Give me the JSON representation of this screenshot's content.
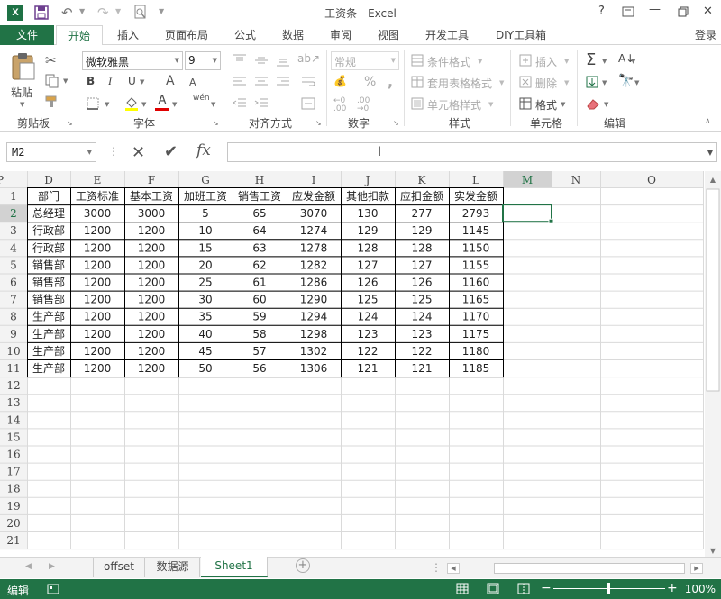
{
  "title": "工资条 - Excel",
  "window_controls": {
    "help": "?",
    "minimize": "—",
    "close": "✕"
  },
  "login": "登录",
  "tabs": [
    "文件",
    "开始",
    "插入",
    "页面布局",
    "公式",
    "数据",
    "审阅",
    "视图",
    "开发工具",
    "DIY工具箱"
  ],
  "active_tab": "开始",
  "ribbon": {
    "clipboard": {
      "paste": "粘贴",
      "label": "剪贴板"
    },
    "font": {
      "name": "微软雅黑",
      "size": "9",
      "bold": "B",
      "italic": "I",
      "underline": "U",
      "grow": "A",
      "shrink": "A",
      "color": "A",
      "label": "字体",
      "wen": "wén"
    },
    "alignment": {
      "label": "对齐方式"
    },
    "number": {
      "format": "常规",
      "percent": "%",
      "comma": ",",
      "label": "数字"
    },
    "styles": {
      "conditional": "条件格式",
      "table": "套用表格格式",
      "cell": "单元格样式",
      "label": "样式"
    },
    "cells": {
      "insert": "插入",
      "delete": "删除",
      "format": "格式",
      "label": "单元格"
    },
    "editing": {
      "label": "编辑"
    }
  },
  "name_box": "M2",
  "formula_value": "",
  "columns": [
    "D",
    "E",
    "F",
    "G",
    "H",
    "I",
    "J",
    "K",
    "L",
    "M",
    "N",
    "O",
    "P"
  ],
  "selected_column": "M",
  "rows": [
    "1",
    "2",
    "3",
    "4",
    "5",
    "6",
    "7",
    "8",
    "9",
    "10",
    "11",
    "12",
    "13",
    "14",
    "15",
    "16",
    "17",
    "18",
    "19",
    "20",
    "21"
  ],
  "selected_row": "2",
  "table": {
    "headers": [
      "部门",
      "工资标准",
      "基本工资",
      "加班工资",
      "销售工资",
      "应发金额",
      "其他扣款",
      "应扣金额",
      "实发金额"
    ],
    "data": [
      [
        "总经理",
        "3000",
        "3000",
        "5",
        "65",
        "3070",
        "130",
        "277",
        "2793"
      ],
      [
        "行政部",
        "1200",
        "1200",
        "10",
        "64",
        "1274",
        "129",
        "129",
        "1145"
      ],
      [
        "行政部",
        "1200",
        "1200",
        "15",
        "63",
        "1278",
        "128",
        "128",
        "1150"
      ],
      [
        "销售部",
        "1200",
        "1200",
        "20",
        "62",
        "1282",
        "127",
        "127",
        "1155"
      ],
      [
        "销售部",
        "1200",
        "1200",
        "25",
        "61",
        "1286",
        "126",
        "126",
        "1160"
      ],
      [
        "销售部",
        "1200",
        "1200",
        "30",
        "60",
        "1290",
        "125",
        "125",
        "1165"
      ],
      [
        "生产部",
        "1200",
        "1200",
        "35",
        "59",
        "1294",
        "124",
        "124",
        "1170"
      ],
      [
        "生产部",
        "1200",
        "1200",
        "40",
        "58",
        "1298",
        "123",
        "123",
        "1175"
      ],
      [
        "生产部",
        "1200",
        "1200",
        "45",
        "57",
        "1302",
        "122",
        "122",
        "1180"
      ],
      [
        "生产部",
        "1200",
        "1200",
        "50",
        "56",
        "1306",
        "121",
        "121",
        "1185"
      ]
    ]
  },
  "sheets": [
    "offset",
    "数据源",
    "Sheet1"
  ],
  "active_sheet": "Sheet1",
  "status": {
    "mode": "编辑",
    "zoom": "100%",
    "zoom_minus": "−",
    "zoom_plus": "+"
  }
}
